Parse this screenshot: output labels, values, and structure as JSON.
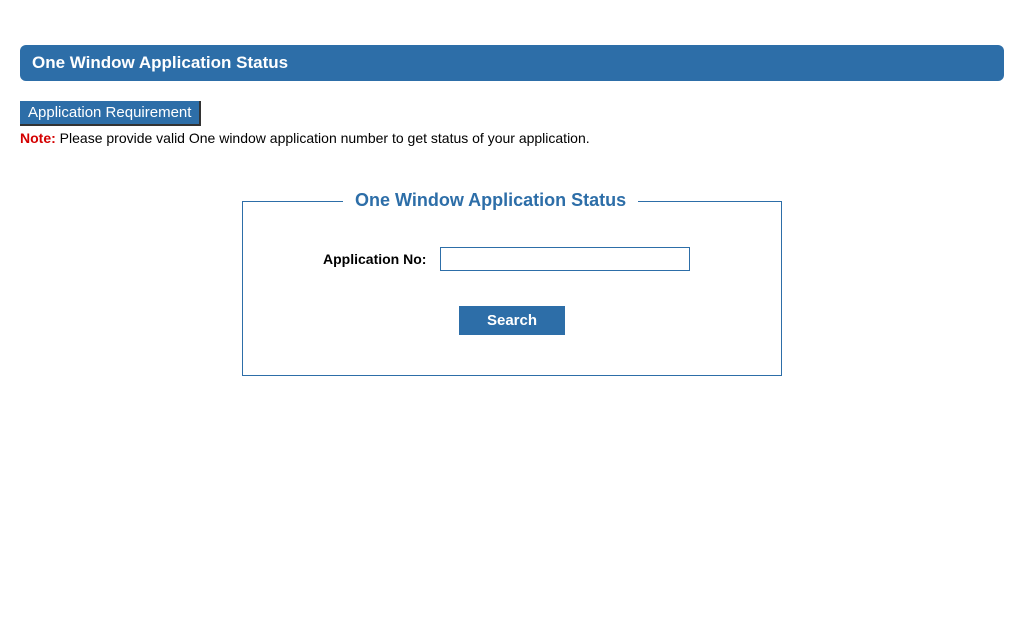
{
  "header": {
    "title": "One Window Application Status"
  },
  "subheader": {
    "requirement_label": "Application Requirement",
    "note_label": "Note:",
    "note_text": " Please provide valid One window application number to get status of your application."
  },
  "form": {
    "legend": "One Window Application Status",
    "application_no_label": "Application No:",
    "application_no_value": "",
    "search_button_label": "Search"
  }
}
